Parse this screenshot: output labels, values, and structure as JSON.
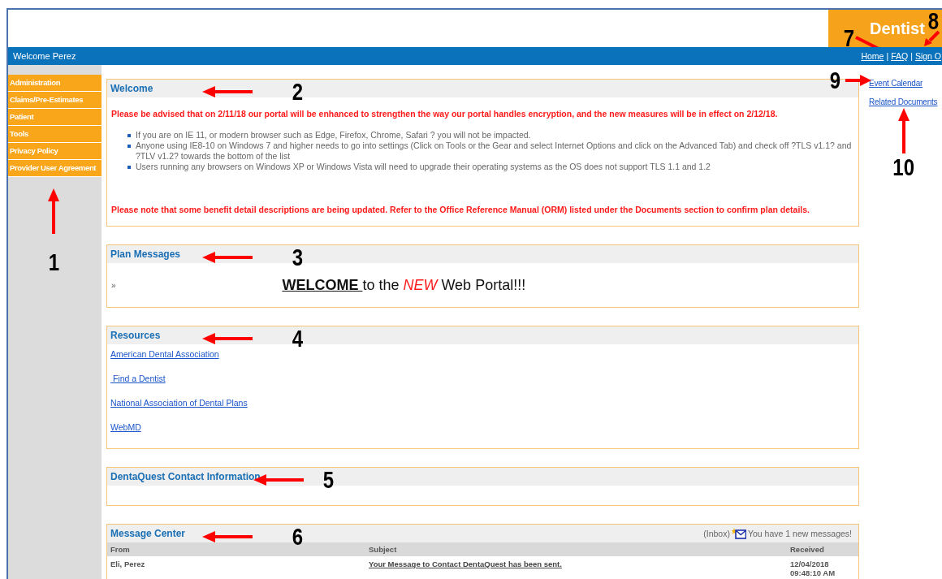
{
  "header": {
    "brand": "Dentist",
    "callout": {
      "number": "7"
    }
  },
  "top_bar": {
    "welcome": "Welcome Perez",
    "separator": "|",
    "links": [
      {
        "label": "Home"
      },
      {
        "label": "FAQ"
      },
      {
        "label": "Sign O"
      }
    ],
    "callout": {
      "number": "8"
    }
  },
  "sidebar": {
    "items": [
      {
        "label": "Administration"
      },
      {
        "label": "Claims/Pre-Estimates"
      },
      {
        "label": "Patient"
      },
      {
        "label": "Tools"
      },
      {
        "label": "Privacy Policy"
      },
      {
        "label": "Provider User Agreement"
      }
    ],
    "callout": {
      "number": "1"
    }
  },
  "sections": [
    {
      "kind": "notice",
      "title": "Welcome",
      "callout": {
        "number": "2"
      },
      "alert": "Please be advised that on 2/11/18 our portal will be enhanced to strengthen the way our portal handles encryption, and the new measures will be in effect on 2/12/18.",
      "bullets": [
        "If you are on IE 11, or modern browser such as Edge, Firefox, Chrome, Safari ? you will not be impacted.",
        "Anyone using IE8-10 on Windows 7 and higher needs to go into settings (Click on Tools or the Gear and select Internet Options and click on the Advanced Tab) and check off ?TLS v1.1? and ?TLV v1.2? towards the bottom of the list",
        "Users running any browsers on Windows XP or Windows Vista will need to upgrade their operating systems as the OS does not support TLS 1.1 and 1.2"
      ],
      "note": "Please note that some benefit detail descriptions are being updated. Refer to the Office Reference Manual (ORM) listed under the Documents section to confirm plan details."
    },
    {
      "kind": "messages",
      "title": "Plan Messages",
      "callout": {
        "number": "3"
      },
      "bullet": "»",
      "message": [
        {
          "text": "WELCOME ",
          "kind": "strong"
        },
        {
          "text": "to the ",
          "kind": "plain"
        },
        {
          "text": "NEW",
          "kind": "highlight"
        },
        {
          "text": " Web Portal!!!",
          "kind": "plain"
        }
      ]
    },
    {
      "kind": "links",
      "title": "Resources",
      "callout": {
        "number": "4"
      },
      "links": [
        {
          "label": "American Dental Association"
        },
        {
          "label": " Find a Dentist"
        },
        {
          "label": "National Association of Dental Plans"
        },
        {
          "label": "WebMD"
        }
      ]
    },
    {
      "kind": "empty",
      "title": "DentaQuest Contact Information",
      "callout": {
        "number": "5"
      }
    },
    {
      "kind": "inbox",
      "title": "Message Center",
      "callout": {
        "number": "6"
      },
      "inbox_label": "(Inbox)",
      "new_messages": "You have 1 new messages!",
      "columns": [
        "From",
        "Subject",
        "Received"
      ],
      "rows": [
        [
          "Eli, Perez",
          "Your Message to Contact DentaQuest has been sent.",
          "12/04/2018 09:48:10 AM"
        ]
      ]
    }
  ],
  "side_links": [
    {
      "label": "Event Calendar",
      "callout": {
        "number": "9"
      }
    },
    {
      "label": "Related Documents",
      "callout": {
        "number": "10"
      }
    }
  ]
}
